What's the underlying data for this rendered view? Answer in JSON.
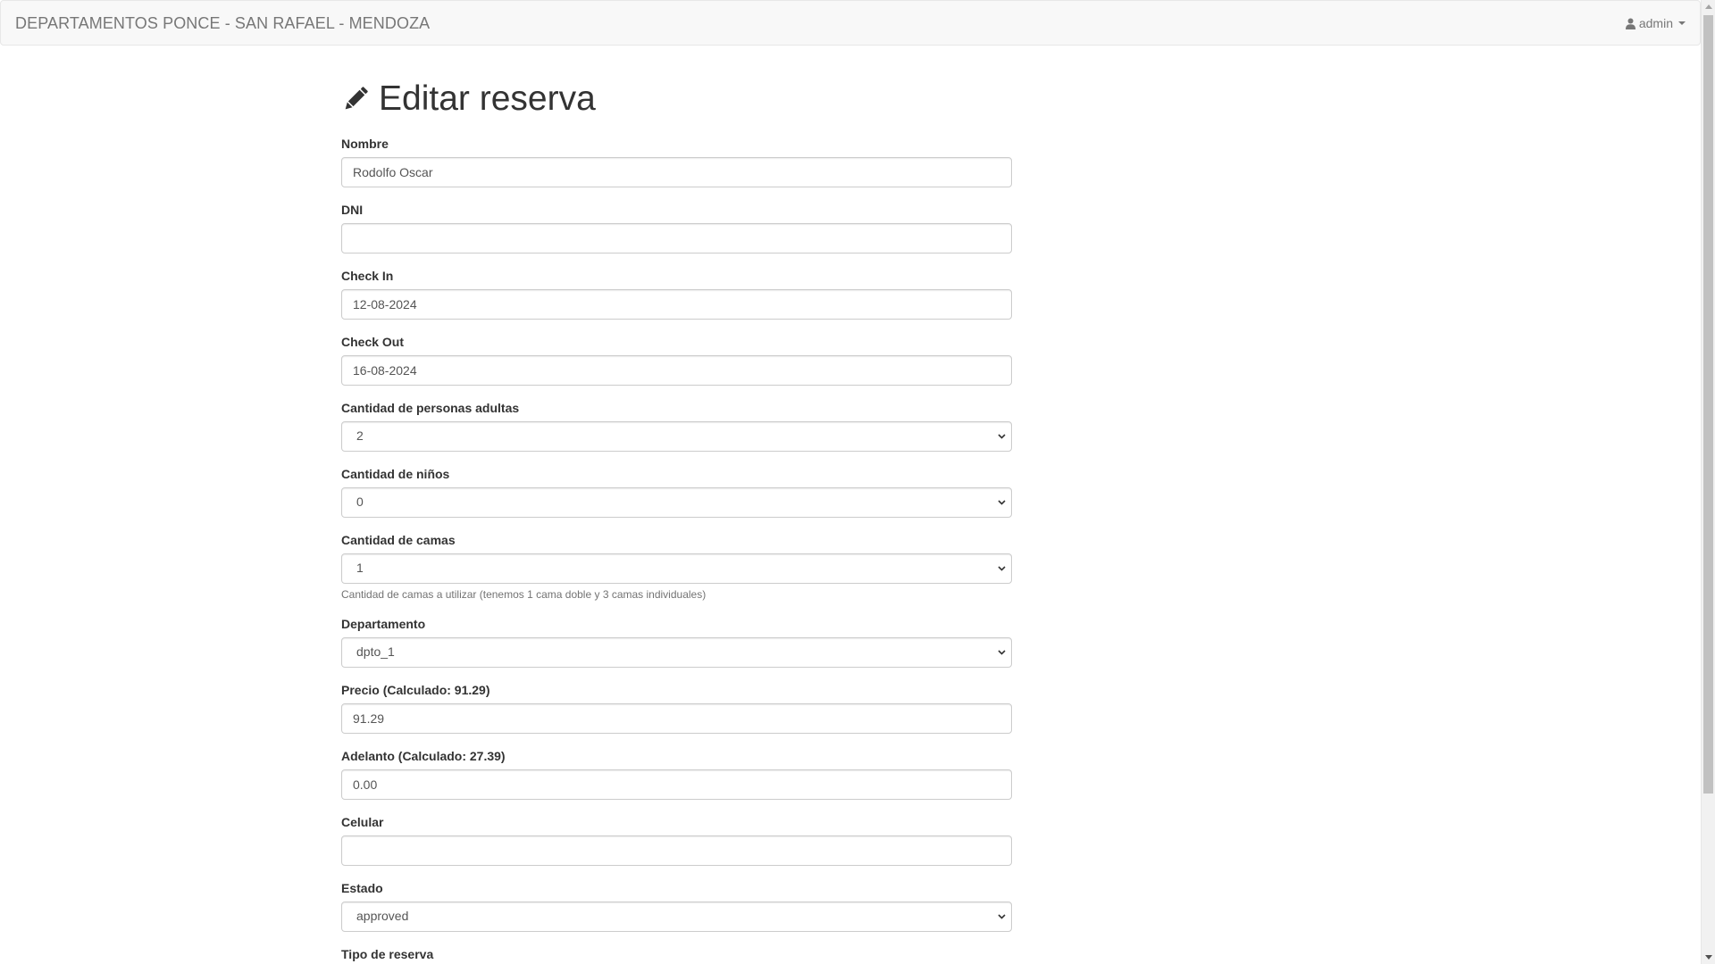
{
  "navbar": {
    "brand": "DEPARTAMENTOS PONCE - SAN RAFAEL - MENDOZA",
    "user_label": "admin"
  },
  "page": {
    "title": "Editar reserva"
  },
  "form": {
    "nombre": {
      "label": "Nombre",
      "value": "Rodolfo Oscar"
    },
    "dni": {
      "label": "DNI",
      "value": ""
    },
    "check_in": {
      "label": "Check In",
      "value": "12-08-2024"
    },
    "check_out": {
      "label": "Check Out",
      "value": "16-08-2024"
    },
    "adultos": {
      "label": "Cantidad de personas adultas",
      "value": "2"
    },
    "ninos": {
      "label": "Cantidad de niños",
      "value": "0"
    },
    "camas": {
      "label": "Cantidad de camas",
      "value": "1",
      "help": "Cantidad de camas a utilizar (tenemos 1 cama doble y 3 camas individuales)"
    },
    "departamento": {
      "label": "Departamento",
      "value": "dpto_1"
    },
    "precio": {
      "label": "Precio (Calculado: 91.29)",
      "value": "91.29"
    },
    "adelanto": {
      "label": "Adelanto (Calculado: 27.39)",
      "value": "0.00"
    },
    "celular": {
      "label": "Celular",
      "value": ""
    },
    "estado": {
      "label": "Estado",
      "value": "approved"
    },
    "tipo_reserva": {
      "label": "Tipo de reserva"
    }
  },
  "icons": {
    "title_icon": "pencil-icon",
    "user_icon": "user-icon",
    "dropdown_icon": "caret-down-icon"
  },
  "colors": {
    "navbar_bg": "#f8f8f8",
    "navbar_text": "#777777",
    "text": "#333333",
    "border": "#cccccc"
  }
}
